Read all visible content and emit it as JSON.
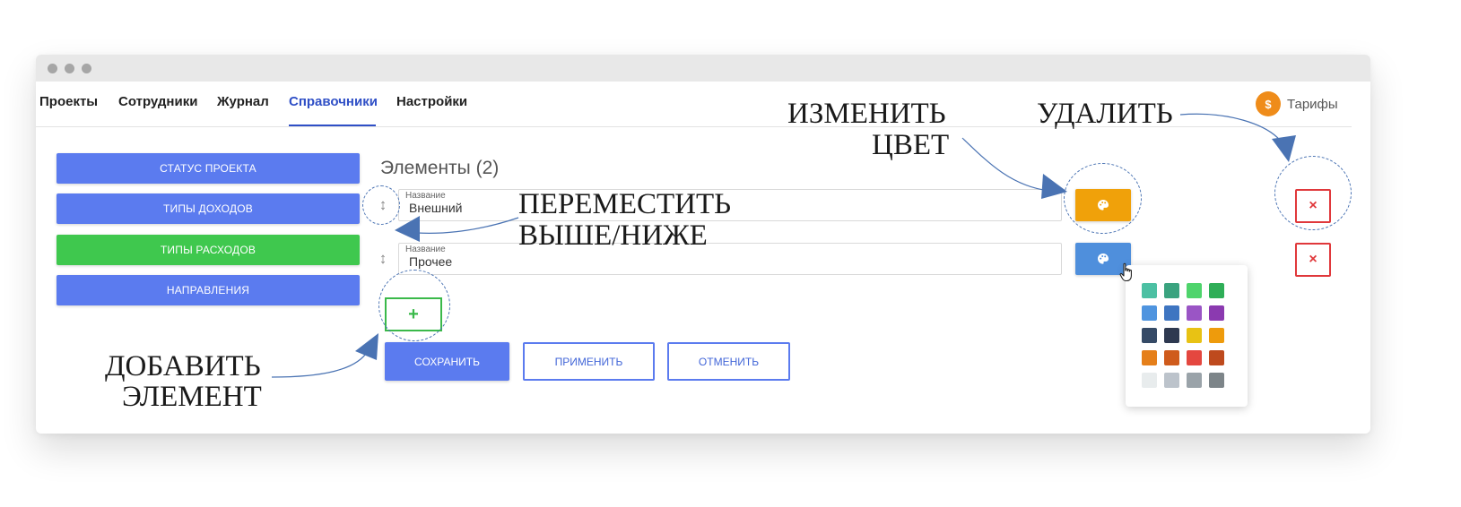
{
  "nav": {
    "items": [
      {
        "label": "Проекты"
      },
      {
        "label": "Сотрудники"
      },
      {
        "label": "Журнал"
      },
      {
        "label": "Справочники"
      },
      {
        "label": "Настройки"
      }
    ],
    "active_index": 3,
    "tariff": {
      "icon": "dollar-coin-icon",
      "symbol": "$",
      "label": "Тарифы"
    }
  },
  "sidebar": {
    "items": [
      {
        "label": "СТАТУС ПРОЕКТА",
        "color": "#5b7bef"
      },
      {
        "label": "ТИПЫ ДОХОДОВ",
        "color": "#5b7bef"
      },
      {
        "label": "ТИПЫ РАСХОДОВ",
        "color": "#3fc84e"
      },
      {
        "label": "НАПРАВЛЕНИЯ",
        "color": "#5b7bef"
      }
    ]
  },
  "elements": {
    "title": "Элементы (2)",
    "rows": [
      {
        "field_label": "Название",
        "value": "Внешний",
        "color": "#f0a10a",
        "color_icon": "palette-icon",
        "delete_icon": "close-icon",
        "delete_symbol": "×",
        "drag_icon": "move-vertical-icon",
        "drag_symbol": "↕"
      },
      {
        "field_label": "Название",
        "value": "Прочее",
        "color": "#4f8fdc",
        "color_icon": "palette-icon",
        "delete_icon": "close-icon",
        "delete_symbol": "×",
        "drag_icon": "move-vertical-icon",
        "drag_symbol": "↕"
      }
    ],
    "add_symbol": "+"
  },
  "actions": {
    "save": "СОХРАНИТЬ",
    "apply": "ПРИМЕНИТЬ",
    "cancel": "ОТМЕНИТЬ"
  },
  "palette": {
    "colors": [
      [
        "#4cc0a3",
        "#3aa37f",
        "#4fd46c",
        "#2fae57"
      ],
      [
        "#4f94df",
        "#3e75c1",
        "#9a55c5",
        "#8b3ab0"
      ],
      [
        "#354a66",
        "#2e3950",
        "#e8c214",
        "#ee9b0c"
      ],
      [
        "#e57f1a",
        "#cf5b1c",
        "#e4473f",
        "#be4a1d"
      ],
      [
        "#e8eced",
        "#bcc3cb",
        "#9aa3a9",
        "#7d8589"
      ]
    ]
  },
  "annotations": {
    "change_color": [
      "ИЗМЕНИТЬ",
      "ЦВЕТ"
    ],
    "delete": [
      "УДАЛИТЬ"
    ],
    "move": [
      "ПЕРЕМЕСТИТЬ",
      "ВЫШЕ/НИЖЕ"
    ],
    "add": [
      "ДОБАВИТЬ",
      "ЭЛЕМЕНТ"
    ]
  }
}
